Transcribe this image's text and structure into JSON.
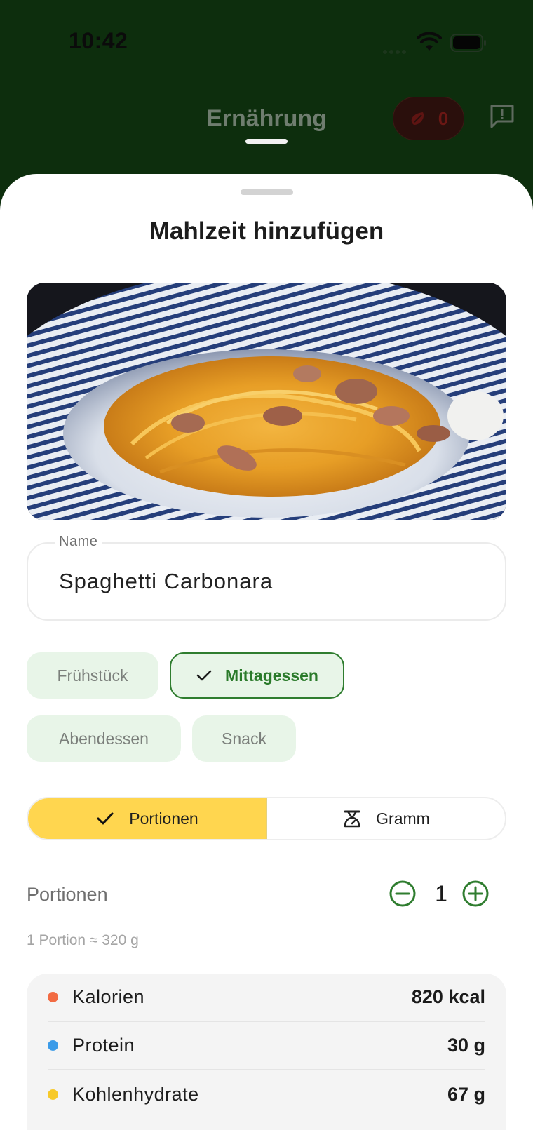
{
  "status_bar": {
    "time": "10:42"
  },
  "header": {
    "title": "Ernährung",
    "points_value": "0"
  },
  "sheet": {
    "title": "Mahlzeit hinzufügen",
    "name_field": {
      "label": "Name",
      "value": "Spaghetti Carbonara"
    },
    "meal_types": [
      {
        "label": "Frühstück",
        "selected": false
      },
      {
        "label": "Mittagessen",
        "selected": true
      },
      {
        "label": "Abendessen",
        "selected": false
      },
      {
        "label": "Snack",
        "selected": false
      }
    ],
    "unit_toggle": {
      "portions_label": "Portionen",
      "grams_label": "Gramm",
      "active": "Portionen"
    },
    "portions": {
      "label": "Portionen",
      "value": "1",
      "hint": "1 Portion ≈ 320 g"
    },
    "nutrition": [
      {
        "label": "Kalorien",
        "value": "820 kcal",
        "color": "#f26b43"
      },
      {
        "label": "Protein",
        "value": "30 g",
        "color": "#3b9be8"
      },
      {
        "label": "Kohlenhydrate",
        "value": "67 g",
        "color": "#f7c928"
      }
    ]
  },
  "colors": {
    "header_background": "#0d2e0d",
    "accent_green": "#2f7d2f",
    "accent_yellow": "#ffd64f"
  }
}
